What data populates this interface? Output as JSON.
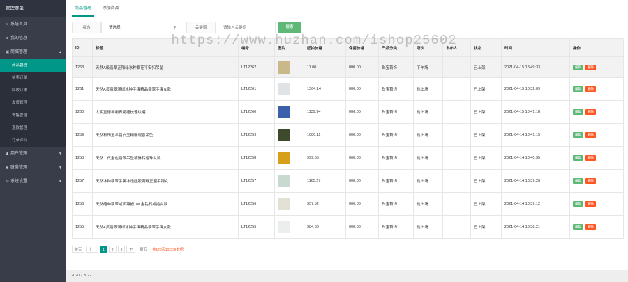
{
  "sidebar": {
    "title": "管理菜单",
    "items": [
      {
        "icon": "home-icon",
        "glyph": "⌂",
        "label": "系统首页"
      },
      {
        "icon": "user-icon",
        "glyph": "◘",
        "label": "我的信息"
      },
      {
        "icon": "shop-icon",
        "glyph": "▣",
        "label": "商城管理",
        "caret": "▲"
      }
    ],
    "subitems": [
      "商品管理",
      "拍卖订单",
      "回收订单",
      "发货管理",
      "寄售管理",
      "退款管理",
      "订单评价"
    ],
    "active_sub": 0,
    "bottom_items": [
      {
        "icon": "users-icon",
        "glyph": "♟",
        "label": "用户管理",
        "caret": "▼"
      },
      {
        "icon": "finance-icon",
        "glyph": "◈",
        "label": "财务管理",
        "caret": "▼"
      },
      {
        "icon": "settings-icon",
        "glyph": "⚙",
        "label": "系统设置",
        "caret": "▼"
      }
    ]
  },
  "tabs": [
    "商品管理",
    "添加商品"
  ],
  "active_tab": 0,
  "filters": {
    "status_label": "状态",
    "status_value": "请选择",
    "keyword_label": "关键词",
    "keyword_placeholder": "请输入关键词",
    "search_label": "搜索"
  },
  "table": {
    "columns": [
      "ID",
      "标题",
      "编号",
      "图片",
      "起拍价格",
      "保留价格",
      "产品分类",
      "场次",
      "发布人",
      "状态",
      "时间",
      "操作"
    ],
    "rows": [
      {
        "id": "1263",
        "title": "天然A级翡翠正阳绿冰种飘花平安扣吊坠",
        "code": "LT12262",
        "img": "#c9b98a",
        "price": "11.00",
        "reserve": "000.00",
        "category": "珠宝首饰",
        "session": "下午场",
        "publisher": "",
        "status": "已上架",
        "time": "2021-04-15 18:49:33"
      },
      {
        "id": "1261",
        "title": "天然A货翡翠满绿冰种手镯精品翡翠手镯女款",
        "code": "LT12261",
        "img": "#dfe3e6",
        "price": "1364.14",
        "reserve": "000.00",
        "category": "珠宝首饰",
        "session": "晚上场",
        "publisher": "",
        "status": "已上架",
        "time": "2021-04-15 10:32:09"
      },
      {
        "id": "1260",
        "title": "大明宣德年制青花缠枝莲纹罐",
        "code": "LT12260",
        "img": "#3b5fa8",
        "price": "1139.94",
        "reserve": "000.00",
        "category": "珠宝首饰",
        "session": "晚上场",
        "publisher": "",
        "status": "已上架",
        "time": "2021-04-15 10:41:18"
      },
      {
        "id": "1259",
        "title": "天然和田玉羊脂白玉精雕观音吊坠",
        "code": "LT12259",
        "img": "#3d4a2e",
        "price": "1086.11",
        "reserve": "000.00",
        "category": "珠宝首饰",
        "session": "晚上场",
        "publisher": "",
        "status": "已上架",
        "time": "2021-04-14 18:41:15"
      },
      {
        "id": "1258",
        "title": "天然二代金包翡翠吊坠貔貅转运珠女款",
        "code": "LT12258",
        "img": "#d6a01c",
        "price": "999.65",
        "reserve": "000.00",
        "category": "珠宝首饰",
        "session": "晚上场",
        "publisher": "",
        "status": "已上架",
        "time": "2021-04-14 18:40:35"
      },
      {
        "id": "1257",
        "title": "天然冰种翡翠手镯冰透起胶满绿正圈手镯女",
        "code": "LT12257",
        "img": "#c8d9cf",
        "price": "1165.27",
        "reserve": "000.00",
        "category": "珠宝首饰",
        "session": "晚上场",
        "publisher": "",
        "status": "已上架",
        "time": "2021-04-14 18:39:26"
      },
      {
        "id": "1256",
        "title": "天然缅甸翡翠戒面镶嵌18K金钻石戒指女款",
        "code": "LT12256",
        "img": "#e3e0d6",
        "price": "957.52",
        "reserve": "000.00",
        "category": "珠宝首饰",
        "session": "晚上场",
        "publisher": "",
        "status": "已上架",
        "time": "2021-04-14 18:39:12"
      },
      {
        "id": "1255",
        "title": "天然A货翡翠满绿冰种手镯精品翡翠手镯女款",
        "code": "LT12255",
        "img": "#eceeee",
        "price": "984.60",
        "reserve": "000.00",
        "category": "珠宝首饰",
        "session": "晚上场",
        "publisher": "",
        "status": "已上架",
        "time": "2021-04-14 18:38:21"
      }
    ],
    "edit_label": "编辑",
    "delete_label": "删除"
  },
  "pager": {
    "first": "首页",
    "prev": "上一",
    "pages": [
      "1",
      "2",
      "3"
    ],
    "current": 0,
    "next": "下",
    "last": "尾页",
    "total": "共120页1022条数据"
  },
  "footer": "2020 - 2022",
  "watermark": "https://www.huzhan.com/ishop25602"
}
